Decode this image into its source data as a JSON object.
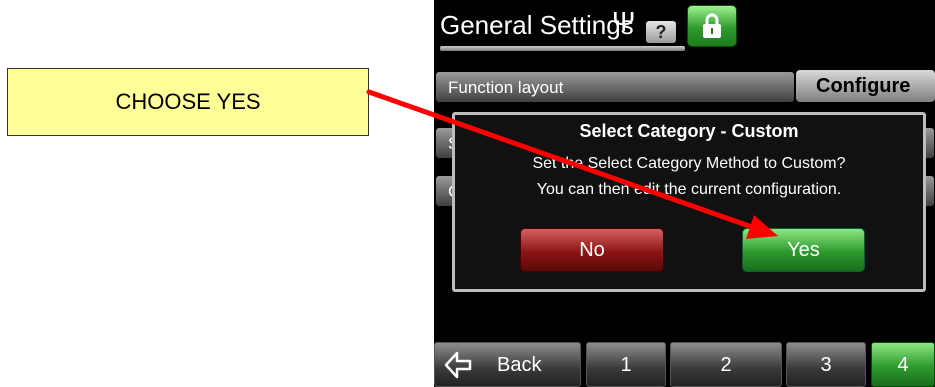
{
  "callout": {
    "text": "CHOOSE YES"
  },
  "header": {
    "title": "General Settings",
    "help_label": "?"
  },
  "settings": {
    "function_layout_label": "Function layout",
    "configure_label": "Configure",
    "row2_label": "S",
    "row3_label": "C"
  },
  "dialog": {
    "title": "Select Category - Custom",
    "message_line1": "Set the Select Category Method to Custom?",
    "message_line2": "You can then edit the current configuration.",
    "no_label": "No",
    "yes_label": "Yes"
  },
  "nav": {
    "back_label": "Back",
    "pages": [
      "1",
      "2",
      "3",
      "4"
    ],
    "active_page": "4"
  },
  "colors": {
    "callout_bg": "#ffff99",
    "arrow": "#ff0000",
    "yes_green": "#2e9a2e",
    "no_red": "#8b1515"
  }
}
